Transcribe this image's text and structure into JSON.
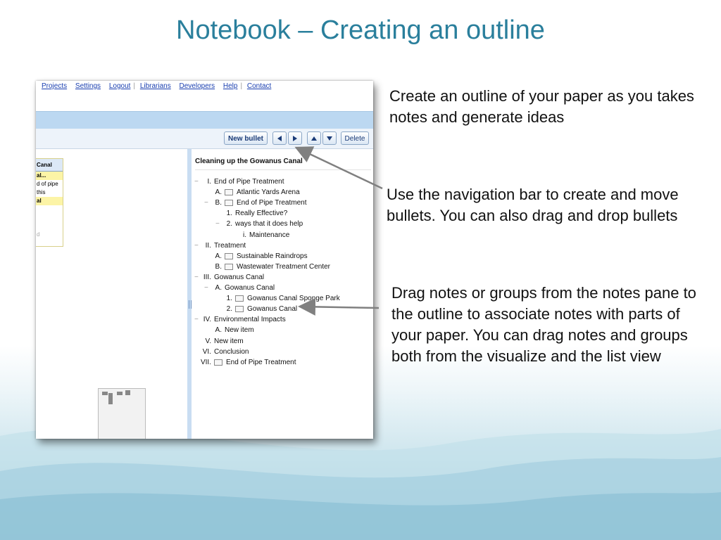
{
  "slide": {
    "title": "Notebook – Creating an outline",
    "notes": [
      "Create an outline of your paper as you takes notes and generate ideas",
      "Use the navigation bar to create and move bullets. You can also drag and drop bullets",
      "Drag notes or groups from the notes pane to the outline to associate notes with parts of your paper. You can drag notes and groups both from the visualize and the list view"
    ]
  },
  "nav": {
    "links": [
      "Projects",
      "Settings",
      "Logout",
      "Librarians",
      "Developers",
      "Help",
      "Contact"
    ]
  },
  "toolbar": {
    "new_bullet": "New bullet",
    "delete": "Delete"
  },
  "notes_pane": {
    "header": "Canal",
    "rows": [
      "al...",
      "d of pipe",
      "this",
      "al",
      "d"
    ]
  },
  "outline": {
    "title": "Cleaning up the Gowanus Canal",
    "items": [
      {
        "marker": "−",
        "num": "I.",
        "text": "End of Pipe Treatment",
        "icon": false
      },
      {
        "marker": "",
        "num": "A.",
        "text": "Atlantic Yards Arena",
        "icon": true
      },
      {
        "marker": "−",
        "num": "B.",
        "text": "End of Pipe Treatment",
        "icon": true
      },
      {
        "marker": "",
        "num": "1.",
        "text": "Really Effective?",
        "icon": false
      },
      {
        "marker": "−",
        "num": "2.",
        "text": "ways that it does help",
        "icon": false
      },
      {
        "marker": "",
        "num": "i.",
        "text": "Maintenance",
        "icon": false
      },
      {
        "marker": "−",
        "num": "II.",
        "text": "Treatment",
        "icon": false
      },
      {
        "marker": "",
        "num": "A.",
        "text": "Sustainable Raindrops",
        "icon": true
      },
      {
        "marker": "",
        "num": "B.",
        "text": "Wastewater Treatment Center",
        "icon": true
      },
      {
        "marker": "−",
        "num": "III.",
        "text": "Gowanus Canal",
        "icon": false
      },
      {
        "marker": "−",
        "num": "A.",
        "text": "Gowanus Canal",
        "icon": false
      },
      {
        "marker": "",
        "num": "1.",
        "text": "Gowanus Canal Sponge Park",
        "icon": true
      },
      {
        "marker": "",
        "num": "2.",
        "text": "Gowanus Canal",
        "icon": true
      },
      {
        "marker": "−",
        "num": "IV.",
        "text": "Environmental Impacts",
        "icon": false
      },
      {
        "marker": "",
        "num": "A.",
        "text": "New item",
        "icon": false
      },
      {
        "marker": "",
        "num": "V.",
        "text": "New item",
        "icon": false
      },
      {
        "marker": "",
        "num": "VI.",
        "text": "Conclusion",
        "icon": false
      },
      {
        "marker": "",
        "num": "VII.",
        "text": "End of Pipe Treatment",
        "icon": true
      }
    ]
  },
  "colors": {
    "title": "#2a7f9c",
    "link": "#1a3fb0",
    "toolbar_bar": "#bcd8f1"
  }
}
